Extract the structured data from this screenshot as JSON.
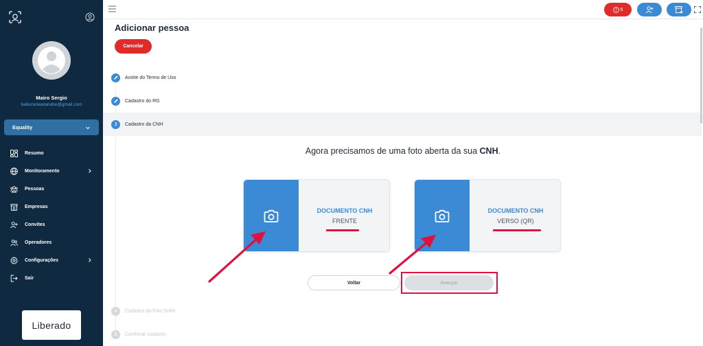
{
  "sidebar": {
    "user_name": "Mairo Sergio",
    "user_email": "baltezanwatanabe@gmail.com",
    "org_select": "Equality",
    "items": [
      {
        "label": "Resumo",
        "icon": "grid-icon"
      },
      {
        "label": "Monitoramento",
        "icon": "globe-icon"
      },
      {
        "label": "Pessoas",
        "icon": "people-icon"
      },
      {
        "label": "Empresas",
        "icon": "building-icon"
      },
      {
        "label": "Convites",
        "icon": "user-plus-icon"
      },
      {
        "label": "Operadores",
        "icon": "operators-icon"
      },
      {
        "label": "Configurações",
        "icon": "gear-icon"
      },
      {
        "label": "Sair",
        "icon": "logout-icon"
      }
    ],
    "brand": "Liberado"
  },
  "topbar": {
    "alert_count": "6"
  },
  "main": {
    "title": "Adicionar pessoa",
    "cancel_label": "Cancelar",
    "steps": [
      {
        "label": "Aceite do Termo de Uso",
        "status": "done"
      },
      {
        "label": "Cadastro do RG",
        "status": "done"
      },
      {
        "number": "3",
        "label": "Cadastro da CNH",
        "status": "active"
      },
      {
        "number": "4",
        "label": "Cadastro da Foto Selfie",
        "status": "disabled"
      },
      {
        "number": "5",
        "label": "Confirmar cadastro",
        "status": "disabled"
      }
    ],
    "prompt_prefix": "Agora precisamos de uma foto aberta da sua ",
    "prompt_bold": "CNH",
    "prompt_suffix": ".",
    "cards": [
      {
        "title": "DOCUMENTO CNH",
        "subtitle": "FRENTE"
      },
      {
        "title": "DOCUMENTO CNH",
        "subtitle": "VERSO (QR)"
      }
    ],
    "back_label": "Voltar",
    "next_label": "Avançar"
  },
  "colors": {
    "sidebar_bg": "#0f2a40",
    "accent_blue": "#3a8ad6",
    "danger_red": "#e02b2b",
    "annotation_red": "#e01040"
  }
}
